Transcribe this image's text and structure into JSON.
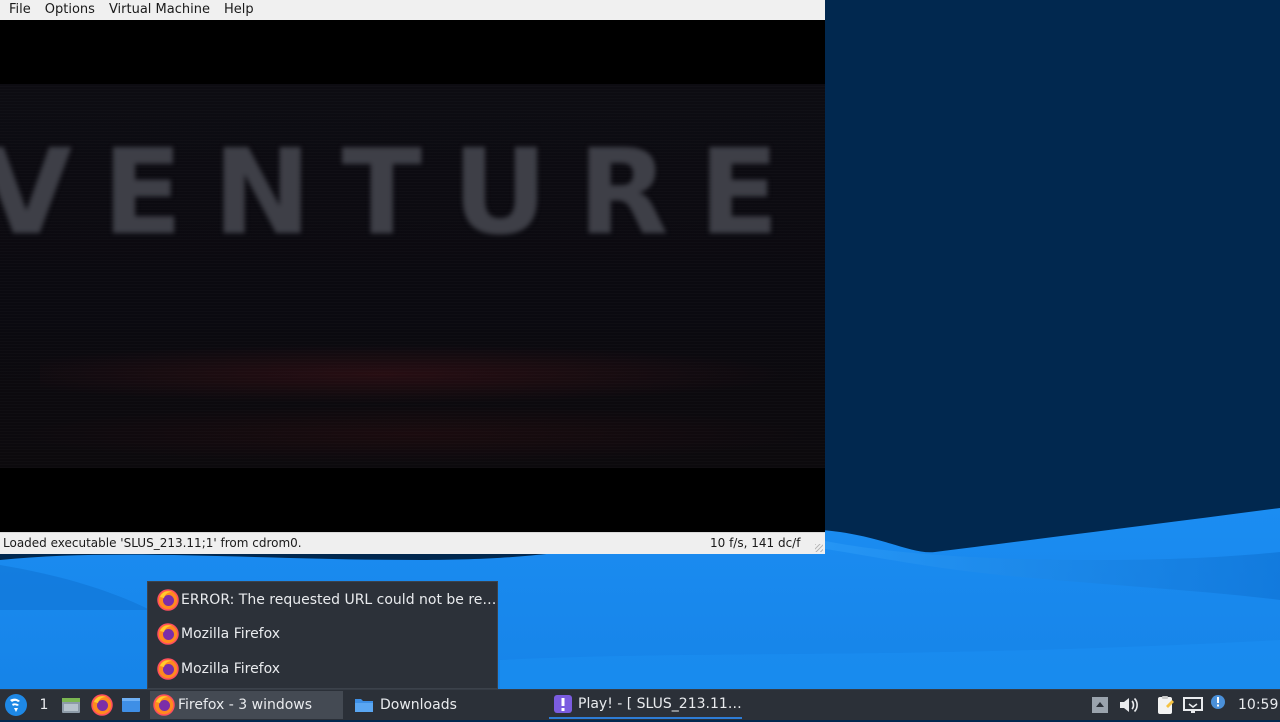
{
  "emulator": {
    "menu": [
      "File",
      "Options",
      "Virtual Machine",
      "Help"
    ],
    "game_title": "VENTURE",
    "status_message": "Loaded executable 'SLUS_213.11;1' from cdrom0.",
    "status_stats": "10 f/s, 141 dc/f"
  },
  "popup": {
    "items": [
      {
        "label": "ERROR: The requested URL could not be re…",
        "icon": "firefox-icon"
      },
      {
        "label": "Mozilla Firefox",
        "icon": "firefox-icon"
      },
      {
        "label": "Mozilla Firefox",
        "icon": "firefox-icon"
      }
    ]
  },
  "taskbar": {
    "workspace": "1",
    "tasks": {
      "firefox": "Firefox - 3 windows",
      "downloads": "Downloads",
      "play": "Play! - [ SLUS_213.11;…"
    },
    "clock": "10:59"
  },
  "colors": {
    "desktop_dark": "#01284f",
    "desktop_light_blue": "#1a8cf0",
    "panel": "#2b3038",
    "accent": "#2d7cd6"
  }
}
